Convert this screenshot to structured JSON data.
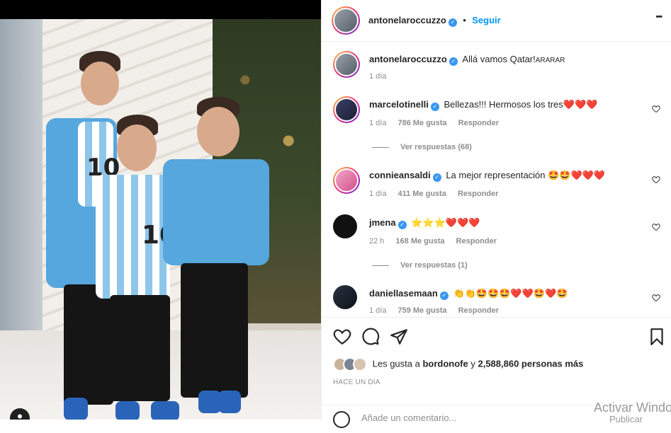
{
  "post": {
    "author": "antonelaroccuzzo",
    "follow_label": "Seguir",
    "separator": "•",
    "more_label": "•••",
    "caption": "Allá vamos Qatar!",
    "caption_suffix": "ARARAR",
    "caption_age": "1 día",
    "jersey_number": "10"
  },
  "comments": [
    {
      "user": "marcelotinelli",
      "text": "Bellezas!!! Hermosos los tres",
      "emoji": "❤️❤️❤️",
      "age": "1 día",
      "likes": "786 Me gusta",
      "reply": "Responder",
      "view_replies": "Ver respuestas (68)"
    },
    {
      "user": "connieansaldi",
      "text": "La mejor representación",
      "emoji": "🤩🤩❤️❤️❤️",
      "age": "1 día",
      "likes": "411 Me gusta",
      "reply": "Responder"
    },
    {
      "user": "jmena",
      "text": "",
      "emoji": "⭐⭐⭐❤️❤️❤️",
      "age": "22 h",
      "likes": "168 Me gusta",
      "reply": "Responder",
      "view_replies": "Ver respuestas (1)"
    },
    {
      "user": "daniellasemaan",
      "text": "",
      "emoji": "👏👏🤩🤩🤩❤️❤️🤩❤️🤩",
      "age": "1 día",
      "likes": "759 Me gusta",
      "reply": "Responder"
    }
  ],
  "likes_summary": {
    "prefix": "Les gusta a",
    "user": "bordonofe",
    "connector": "y",
    "count": "2,588,860 personas más"
  },
  "time_ago": "HACE UN DÍA",
  "add_comment_placeholder": "Añade un comentario...",
  "watermark": {
    "line1": "Activar Windows",
    "line2": "Publicar"
  },
  "colors": {
    "accent": "#0095f6",
    "verified": "#3897f0",
    "heart_red": "#ed4956"
  },
  "icons": [
    "heart-icon",
    "comment-icon",
    "share-icon",
    "bookmark-icon",
    "more-icon",
    "user-tag-icon",
    "smile-icon",
    "verified-icon"
  ]
}
